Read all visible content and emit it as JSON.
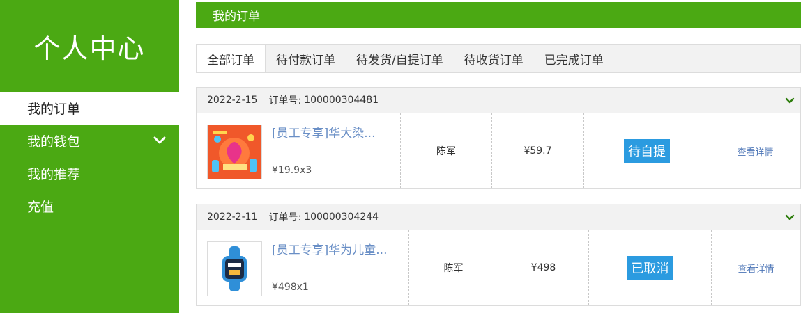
{
  "sidebar": {
    "title": "个人中心",
    "items": [
      {
        "label": "我的订单",
        "active": true
      },
      {
        "label": "我的钱包",
        "has_submenu": true
      },
      {
        "label": "我的推荐"
      },
      {
        "label": "充值"
      }
    ]
  },
  "main": {
    "section_title": "我的订单",
    "tabs": [
      {
        "label": "全部订单",
        "active": true
      },
      {
        "label": "待付款订单"
      },
      {
        "label": "待发货/自提订单"
      },
      {
        "label": "待收货订单"
      },
      {
        "label": "已完成订单"
      }
    ],
    "order_no_label": "订单号:",
    "orders": [
      {
        "date": "2022-2-15",
        "order_no": "100000304481",
        "product_name": "[员工专享]华大染...",
        "unit_price_qty": "¥19.9x3",
        "recipient": "陈军",
        "total": "¥59.7",
        "status": "待自提",
        "detail_link": "查看详情"
      },
      {
        "date": "2022-2-11",
        "order_no": "100000304244",
        "product_name": "[员工专享]华为儿童...",
        "unit_price_qty": "¥498x1",
        "recipient": "陈军",
        "total": "¥498",
        "status": "已取消",
        "detail_link": "查看详情"
      }
    ]
  },
  "colors": {
    "brand_green": "#4ba913",
    "status_blue": "#2b9be0",
    "link_blue": "#4b74b6"
  }
}
